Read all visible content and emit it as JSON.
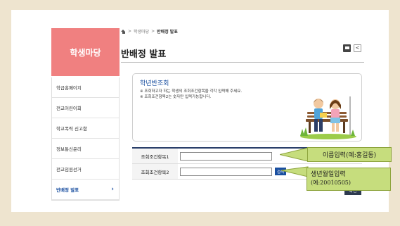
{
  "sidebar": {
    "title": "학생마당",
    "items": [
      {
        "label": "학급홈페이지"
      },
      {
        "label": "전교어린이회"
      },
      {
        "label": "학교폭력 신고함"
      },
      {
        "label": "정보통신윤리"
      },
      {
        "label": "전교임원선거"
      },
      {
        "label": "반배정 발표",
        "active": true
      }
    ]
  },
  "breadcrumb": {
    "items": [
      "학생마당",
      "반배정 발표"
    ],
    "separator": ">"
  },
  "page": {
    "title": "반배정 발표",
    "share_glyph": "<"
  },
  "info": {
    "title": "학년반조회",
    "note1": "※ 조회하고자 하는 학생의 조회조건항목을 각각 입력해 주세요.",
    "note2": "※ 조회조건항목2는 숫자만 입력가능합니다."
  },
  "form": {
    "label1": "조회조건항목1",
    "value1": "",
    "label2": "조회조건항목2",
    "value2": "",
    "search_label": "검색",
    "confirm_label": "확인"
  },
  "annotations": {
    "name_hint": "이름입력(예:홍길동)",
    "birth_hint": "생년월일입력",
    "birth_example": "(예:20010505)"
  },
  "colors": {
    "sidebar_header": "#f08080",
    "accent": "#1a4fa0",
    "callout": "#c6dd7d",
    "background": "#eee4cf"
  }
}
